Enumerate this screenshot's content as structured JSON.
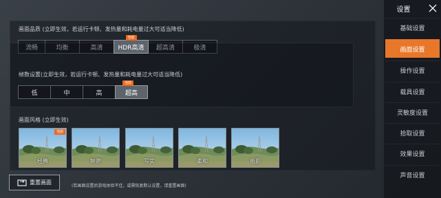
{
  "quality": {
    "title": "画面品质 (立即生效，若运行卡顿、发热量和耗电量过大可适当降低)",
    "options": [
      "流畅",
      "均衡",
      "高清",
      "HDR高清",
      "超高清",
      "极清"
    ],
    "selected_index": 3,
    "badge": "当前"
  },
  "fps": {
    "title": "帧数设置(立即生效，若运行卡顿、发热量和耗电量过大可适当降低)",
    "options": [
      "低",
      "中",
      "高",
      "超高"
    ],
    "selected_index": 3,
    "badge": "当前"
  },
  "style": {
    "title": "画面风格 (立即生效)",
    "thumbs": [
      {
        "label": "经典",
        "badge": "当前"
      },
      {
        "label": "鲜艳",
        "badge": ""
      },
      {
        "label": "写实",
        "badge": ""
      },
      {
        "label": "柔和",
        "badge": ""
      },
      {
        "label": "电影",
        "badge": ""
      }
    ]
  },
  "footer": {
    "reset_label": "重置画面",
    "hint": "(若画面设置后游戏体验不佳，或需恢复默认设置，请重置画面)"
  },
  "sidebar": {
    "title": "设置",
    "items": [
      "基础设置",
      "画面设置",
      "操作设置",
      "载具设置",
      "灵敏度设置",
      "拾取设置",
      "效果设置",
      "声音设置"
    ],
    "active_index": 1
  },
  "colors": {
    "accent": "#e8772a",
    "badge": "#e86a1f"
  }
}
